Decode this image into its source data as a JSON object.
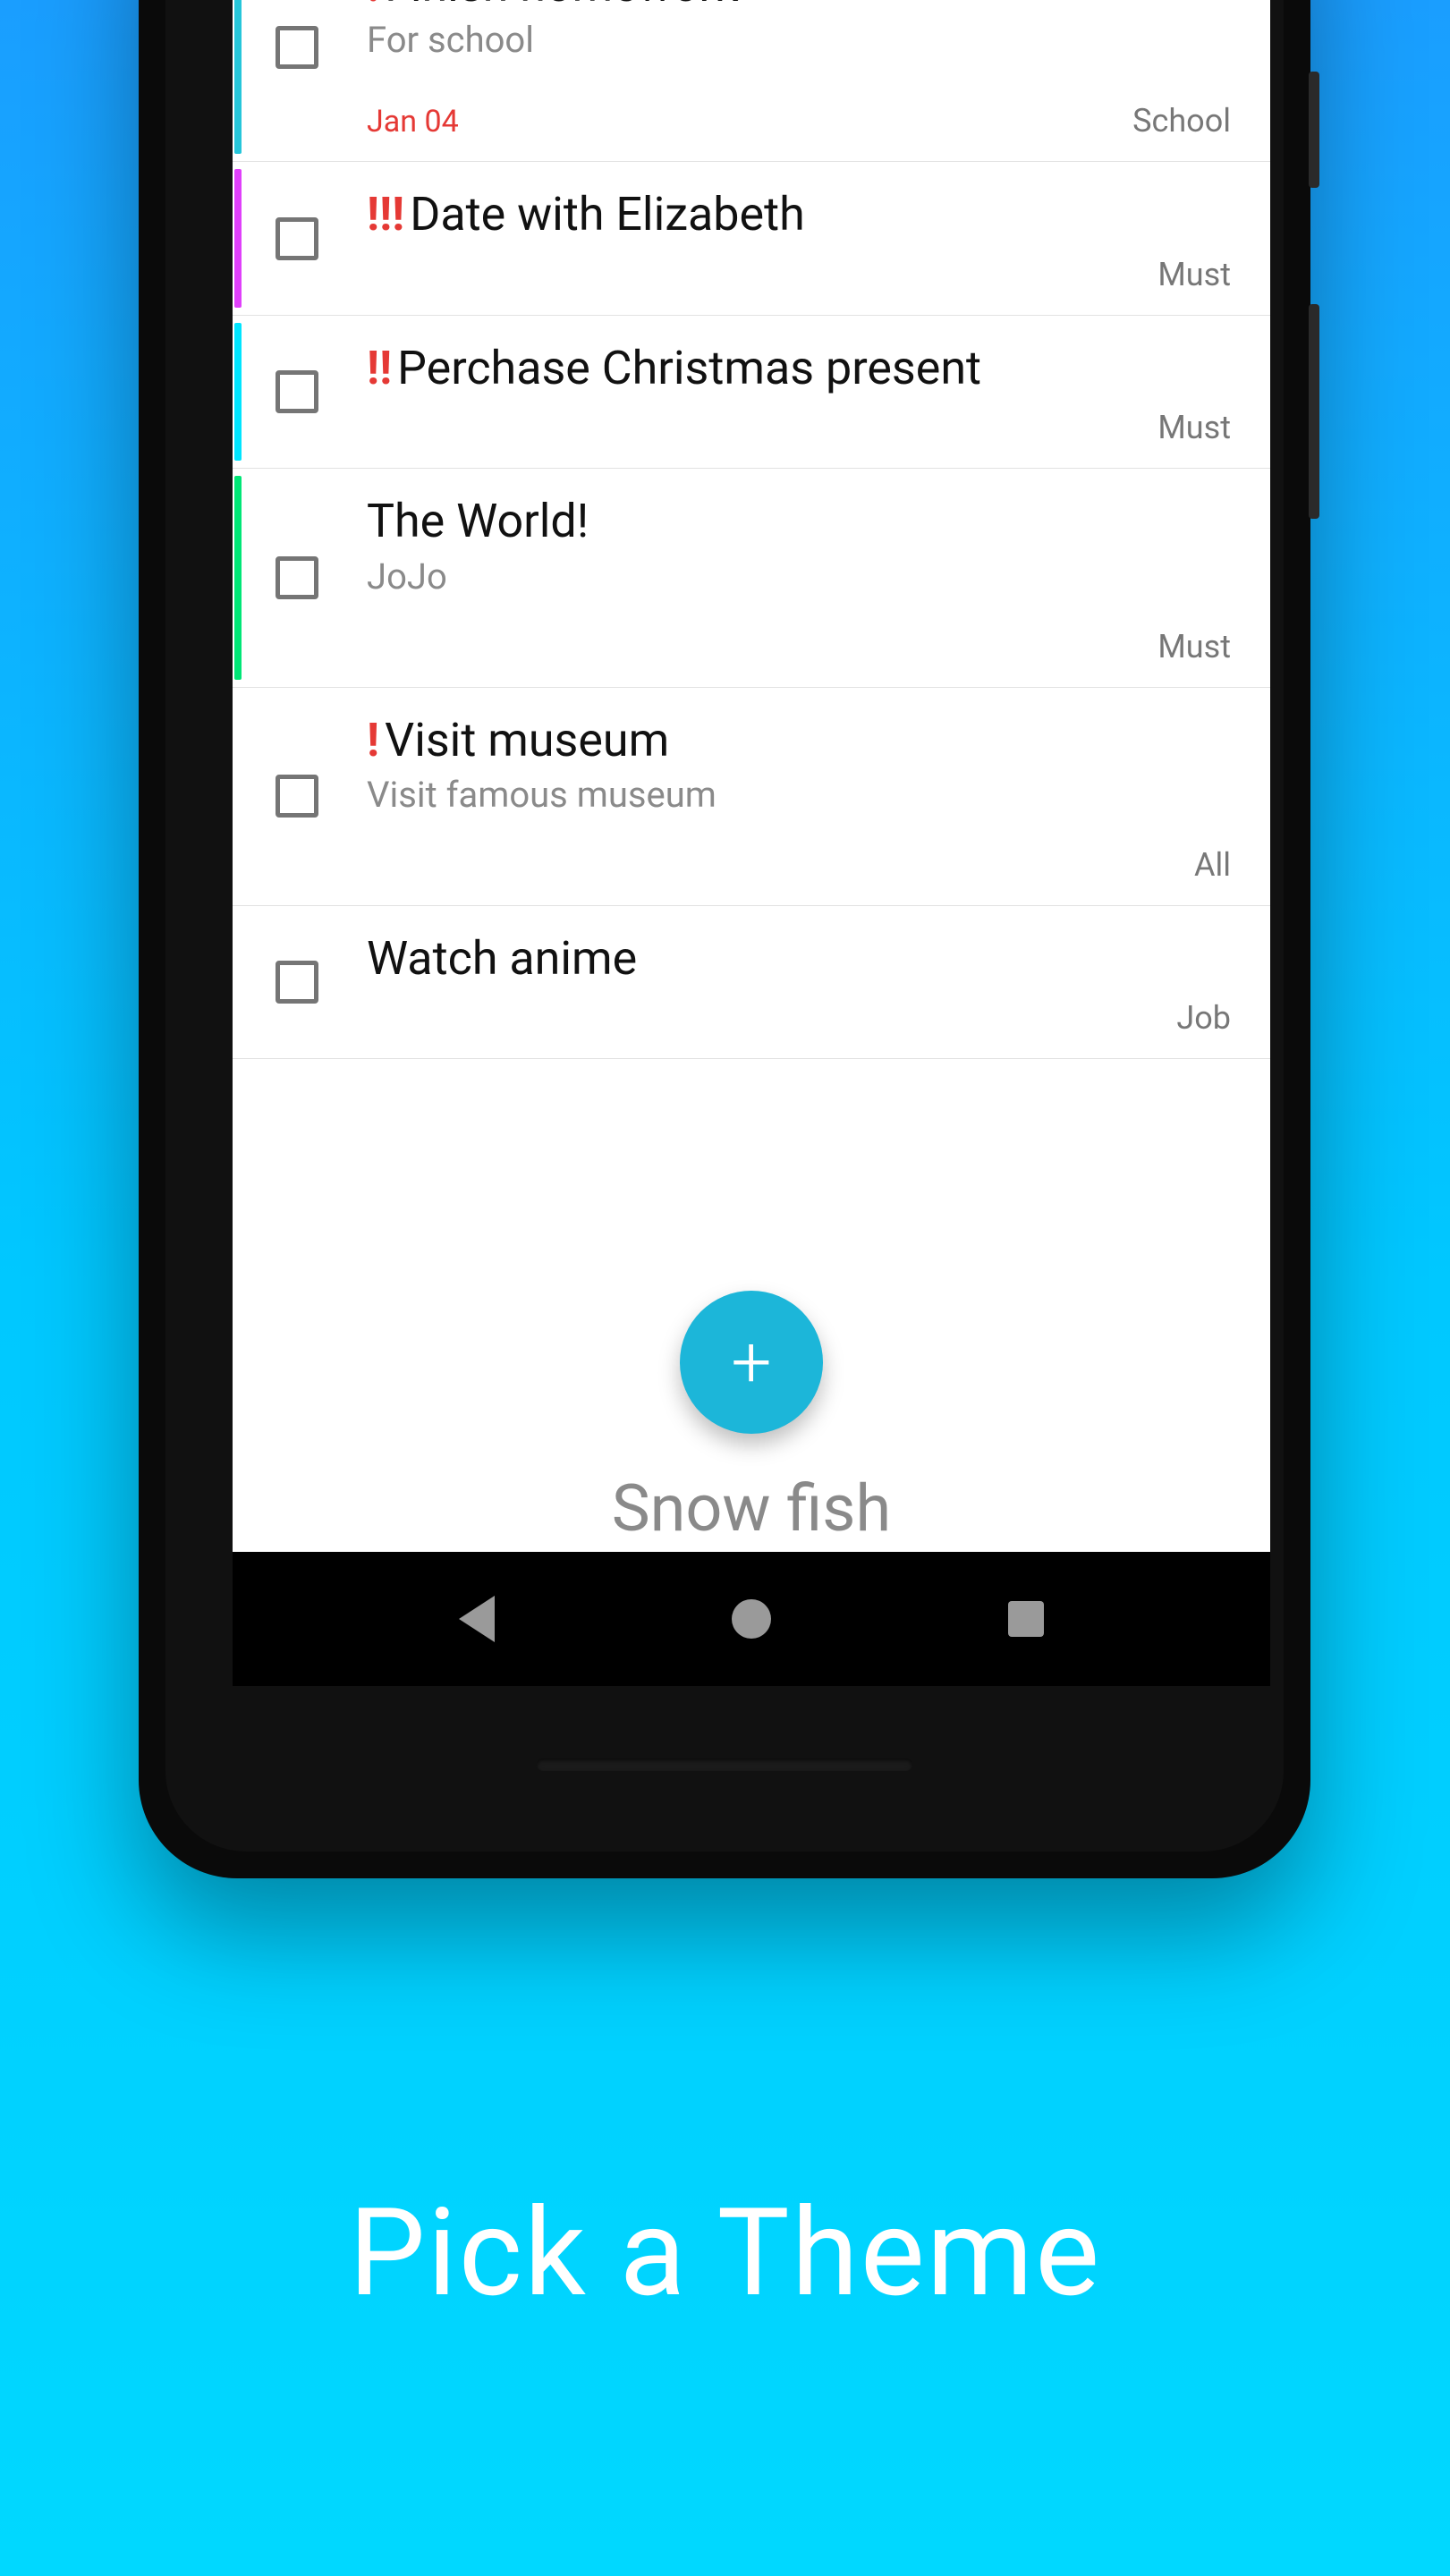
{
  "promo_text": "Pick a Theme",
  "footer_label": "Snow fish",
  "fab_label": "+",
  "tasks": [
    {
      "priority": "!",
      "title": "Finish homework",
      "subtitle": "For school",
      "date": "Jan 04",
      "tag": "School",
      "stripe": "#26c6da"
    },
    {
      "priority": "!!!",
      "title": "Date with Elizabeth",
      "subtitle": "",
      "date": "",
      "tag": "Must",
      "stripe": "#e040fb"
    },
    {
      "priority": "!!",
      "title": "Perchase Christmas present",
      "subtitle": "",
      "date": "",
      "tag": "Must",
      "stripe": "#00e5ff"
    },
    {
      "priority": "",
      "title": "The World!",
      "subtitle": "JoJo",
      "date": "",
      "tag": "Must",
      "stripe": "#00e676"
    },
    {
      "priority": "!",
      "title": "Visit museum",
      "subtitle": "Visit famous museum",
      "date": "",
      "tag": "All",
      "stripe": "transparent"
    },
    {
      "priority": "",
      "title": "Watch anime",
      "subtitle": "",
      "date": "",
      "tag": "Job",
      "stripe": "transparent"
    }
  ],
  "colors": {
    "fab": "#1cb6d9",
    "priority": "#e53935"
  }
}
